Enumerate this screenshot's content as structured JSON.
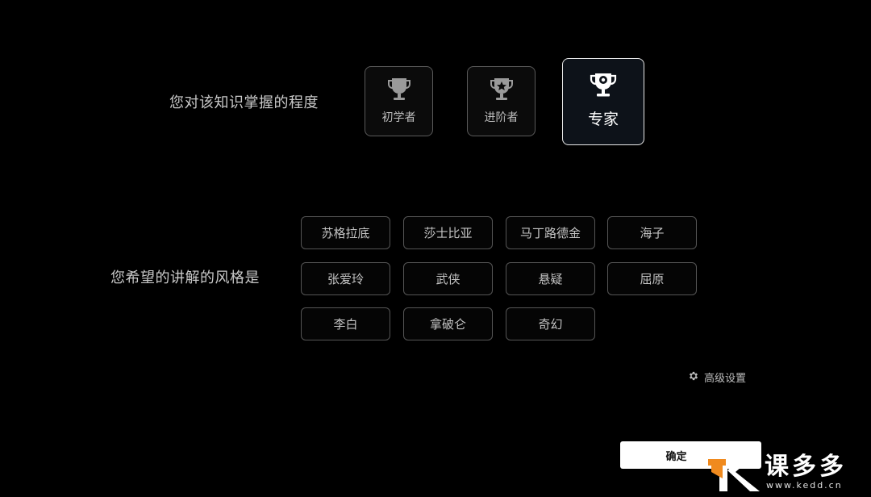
{
  "level_section": {
    "label": "您对该知识掌握的程度",
    "options": [
      {
        "id": "beginner",
        "label": "初学者",
        "selected": false
      },
      {
        "id": "advanced",
        "label": "进阶者",
        "selected": false
      },
      {
        "id": "expert",
        "label": "专家",
        "selected": true
      }
    ]
  },
  "style_section": {
    "label": "您希望的讲解的风格是",
    "options": [
      "苏格拉底",
      "莎士比亚",
      "马丁路德金",
      "海子",
      "张爱玲",
      "武侠",
      "悬疑",
      "屈原",
      "李白",
      "拿破仑",
      "奇幻"
    ]
  },
  "advanced_settings": {
    "label": "高级设置",
    "icon": "gear-icon"
  },
  "confirm": {
    "label": "确定"
  },
  "watermark": {
    "text": "课多多",
    "url": "www.kedd.cn"
  },
  "colors": {
    "background": "#000000",
    "accent_orange": "#f08a1e",
    "selected_border": "#e8e8e8"
  }
}
